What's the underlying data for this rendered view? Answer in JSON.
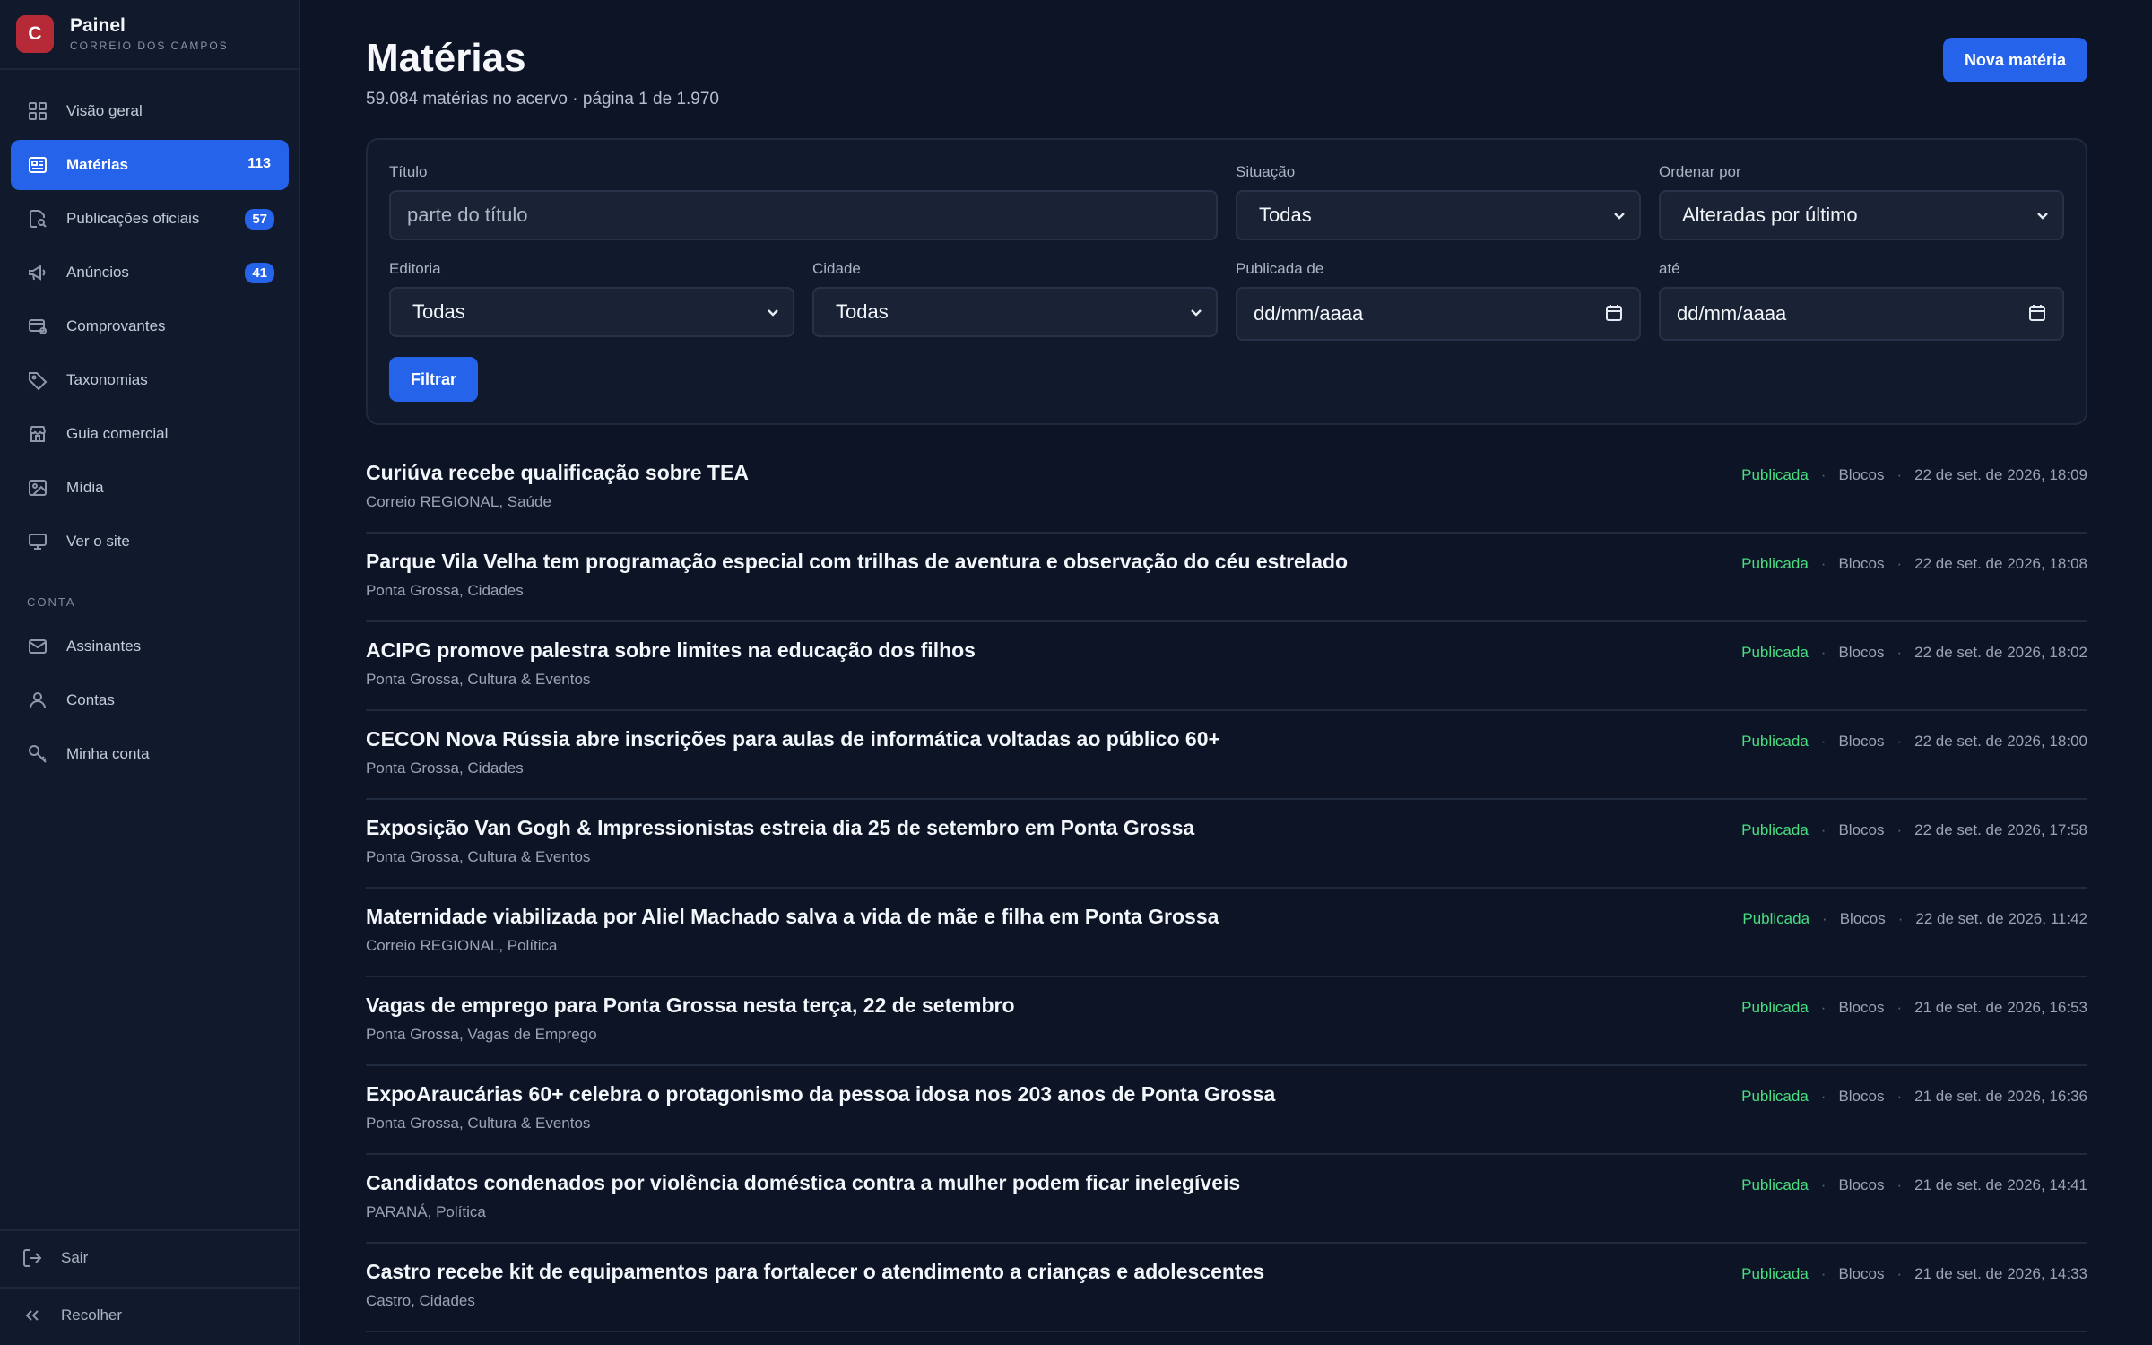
{
  "brand": {
    "logo_letter": "C",
    "title": "Painel",
    "subtitle": "CORREIO DOS CAMPOS"
  },
  "sidebar": {
    "items": [
      {
        "label": "Visão geral",
        "icon": "grid-icon"
      },
      {
        "label": "Matérias",
        "icon": "newspaper-icon",
        "count": "113",
        "active": true
      },
      {
        "label": "Publicações oficiais",
        "icon": "document-search-icon",
        "badge": "57"
      },
      {
        "label": "Anúncios",
        "icon": "megaphone-icon",
        "badge": "41"
      },
      {
        "label": "Comprovantes",
        "icon": "receipt-icon"
      },
      {
        "label": "Taxonomias",
        "icon": "tag-icon"
      },
      {
        "label": "Guia comercial",
        "icon": "store-icon"
      },
      {
        "label": "Mídia",
        "icon": "image-icon"
      },
      {
        "label": "Ver o site",
        "icon": "monitor-icon"
      }
    ],
    "section_label": "CONTA",
    "account_items": [
      {
        "label": "Assinantes",
        "icon": "mail-icon"
      },
      {
        "label": "Contas",
        "icon": "user-icon"
      },
      {
        "label": "Minha conta",
        "icon": "key-icon"
      }
    ],
    "logout_label": "Sair",
    "collapse_label": "Recolher"
  },
  "header": {
    "title": "Matérias",
    "subtitle": "59.084 matérias no acervo · página 1 de 1.970",
    "new_button": "Nova matéria"
  },
  "filters": {
    "title_label": "Título",
    "title_placeholder": "parte do título",
    "status_label": "Situação",
    "status_value": "Todas",
    "order_label": "Ordenar por",
    "order_value": "Alteradas por último",
    "section_label": "Editoria",
    "section_value": "Todas",
    "city_label": "Cidade",
    "city_value": "Todas",
    "from_label": "Publicada de",
    "from_value": "dd/mm/aaaa",
    "to_label": "até",
    "to_value": "dd/mm/aaaa",
    "submit_label": "Filtrar"
  },
  "articles": [
    {
      "title": "Curiúva recebe qualificação sobre TEA",
      "meta": "Correio REGIONAL, Saúde",
      "status": "Publicada",
      "type": "Blocos",
      "date": "22 de set. de 2026, 18:09"
    },
    {
      "title": "Parque Vila Velha tem programação especial com trilhas de aventura e observação do céu estrelado",
      "meta": "Ponta Grossa, Cidades",
      "status": "Publicada",
      "type": "Blocos",
      "date": "22 de set. de 2026, 18:08"
    },
    {
      "title": "ACIPG promove palestra sobre limites na educação dos filhos",
      "meta": "Ponta Grossa, Cultura & Eventos",
      "status": "Publicada",
      "type": "Blocos",
      "date": "22 de set. de 2026, 18:02"
    },
    {
      "title": "CECON Nova Rússia abre inscrições para aulas de informática voltadas ao público 60+",
      "meta": "Ponta Grossa, Cidades",
      "status": "Publicada",
      "type": "Blocos",
      "date": "22 de set. de 2026, 18:00"
    },
    {
      "title": "Exposição Van Gogh & Impressionistas estreia dia 25 de setembro em Ponta Grossa",
      "meta": "Ponta Grossa, Cultura & Eventos",
      "status": "Publicada",
      "type": "Blocos",
      "date": "22 de set. de 2026, 17:58"
    },
    {
      "title": "Maternidade viabilizada por Aliel Machado salva a vida de mãe e filha em Ponta Grossa",
      "meta": "Correio REGIONAL, Política",
      "status": "Publicada",
      "type": "Blocos",
      "date": "22 de set. de 2026, 11:42"
    },
    {
      "title": "Vagas de emprego para Ponta Grossa nesta terça, 22 de setembro",
      "meta": "Ponta Grossa, Vagas de Emprego",
      "status": "Publicada",
      "type": "Blocos",
      "date": "21 de set. de 2026, 16:53"
    },
    {
      "title": "ExpoAraucárias 60+ celebra o protagonismo da pessoa idosa nos 203 anos de Ponta Grossa",
      "meta": "Ponta Grossa, Cultura & Eventos",
      "status": "Publicada",
      "type": "Blocos",
      "date": "21 de set. de 2026, 16:36"
    },
    {
      "title": "Candidatos condenados por violência doméstica contra a mulher podem ficar inelegíveis",
      "meta": "PARANÁ, Política",
      "status": "Publicada",
      "type": "Blocos",
      "date": "21 de set. de 2026, 14:41"
    },
    {
      "title": "Castro recebe kit de equipamentos para fortalecer o atendimento a crianças e adolescentes",
      "meta": "Castro, Cidades",
      "status": "Publicada",
      "type": "Blocos",
      "date": "21 de set. de 2026, 14:33"
    }
  ],
  "colors": {
    "accent": "#2563eb",
    "status_published": "#4ade80",
    "brand_logo": "#b52a36",
    "background": "#0c1426",
    "sidebar": "#111a2c"
  }
}
